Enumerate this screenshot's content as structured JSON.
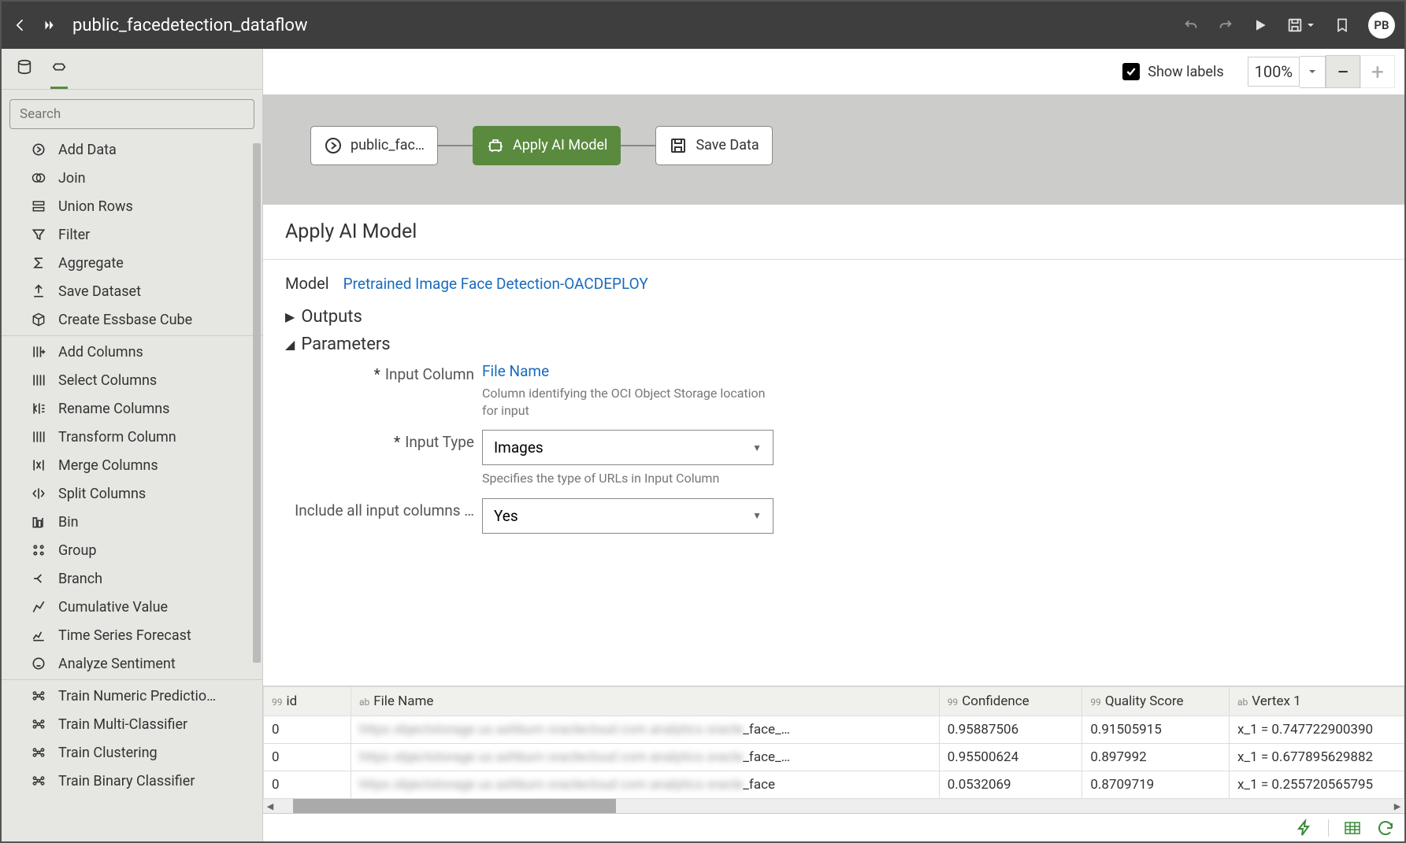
{
  "header": {
    "title": "public_facedetection_dataflow",
    "avatar": "PB"
  },
  "sidebar": {
    "search_placeholder": "Search",
    "items": [
      {
        "label": "Add Data",
        "icon": "arrow-circle"
      },
      {
        "label": "Join",
        "icon": "join"
      },
      {
        "label": "Union Rows",
        "icon": "union"
      },
      {
        "label": "Filter",
        "icon": "filter"
      },
      {
        "label": "Aggregate",
        "icon": "sigma"
      },
      {
        "label": "Save Dataset",
        "icon": "upload"
      },
      {
        "label": "Create Essbase Cube",
        "icon": "cube"
      },
      {
        "label": "Add Columns",
        "icon": "cols-add"
      },
      {
        "label": "Select Columns",
        "icon": "cols-sel"
      },
      {
        "label": "Rename Columns",
        "icon": "cols-rename"
      },
      {
        "label": "Transform Column",
        "icon": "cols-xform"
      },
      {
        "label": "Merge Columns",
        "icon": "cols-merge"
      },
      {
        "label": "Split Columns",
        "icon": "cols-split"
      },
      {
        "label": "Bin",
        "icon": "bin"
      },
      {
        "label": "Group",
        "icon": "group"
      },
      {
        "label": "Branch",
        "icon": "branch"
      },
      {
        "label": "Cumulative Value",
        "icon": "cumul"
      },
      {
        "label": "Time Series Forecast",
        "icon": "forecast"
      },
      {
        "label": "Analyze Sentiment",
        "icon": "sentiment"
      },
      {
        "label": "Train Numeric Predictio…",
        "icon": "train"
      },
      {
        "label": "Train Multi-Classifier",
        "icon": "train"
      },
      {
        "label": "Train Clustering",
        "icon": "train"
      },
      {
        "label": "Train Binary Classifier",
        "icon": "train"
      }
    ]
  },
  "canvas": {
    "show_labels_label": "Show labels",
    "zoom": "100%",
    "nodes": [
      {
        "label": "public_fac…",
        "icon": "arrow-circle",
        "selected": false
      },
      {
        "label": "Apply AI Model",
        "icon": "ai",
        "selected": true
      },
      {
        "label": "Save Data",
        "icon": "save",
        "selected": false
      }
    ]
  },
  "detail": {
    "title": "Apply AI Model",
    "model_label": "Model",
    "model_value": "Pretrained Image Face Detection-OACDEPLOY",
    "outputs_label": "Outputs",
    "parameters_label": "Parameters",
    "params": {
      "input_column": {
        "label": "Input Column",
        "value": "File Name",
        "help": "Column identifying the OCI Object Storage location for input"
      },
      "input_type": {
        "label": "Input Type",
        "value": "Images",
        "help": "Specifies the type of URLs in Input Column"
      },
      "include_all": {
        "label": "Include all input columns …",
        "value": "Yes"
      }
    }
  },
  "table": {
    "columns": [
      {
        "type": "99",
        "name": "id",
        "w": "110"
      },
      {
        "type": "ab",
        "name": "File Name",
        "w": "740"
      },
      {
        "type": "99",
        "name": "Confidence",
        "w": "180"
      },
      {
        "type": "99",
        "name": "Quality Score",
        "w": "185"
      },
      {
        "type": "ab",
        "name": "Vertex 1",
        "w": "220"
      }
    ],
    "rows": [
      {
        "id": "0",
        "file": "_face_…",
        "conf": "0.95887506",
        "qs": "0.91505915",
        "vx": "x_1 = 0.747722900390"
      },
      {
        "id": "0",
        "file": "_face_…",
        "conf": "0.95500624",
        "qs": "0.897992",
        "vx": "x_1 = 0.677895629882"
      },
      {
        "id": "0",
        "file": "_face",
        "conf": "0.0532069",
        "qs": "0.8709719",
        "vx": "x_1 = 0.255720565795"
      }
    ]
  }
}
